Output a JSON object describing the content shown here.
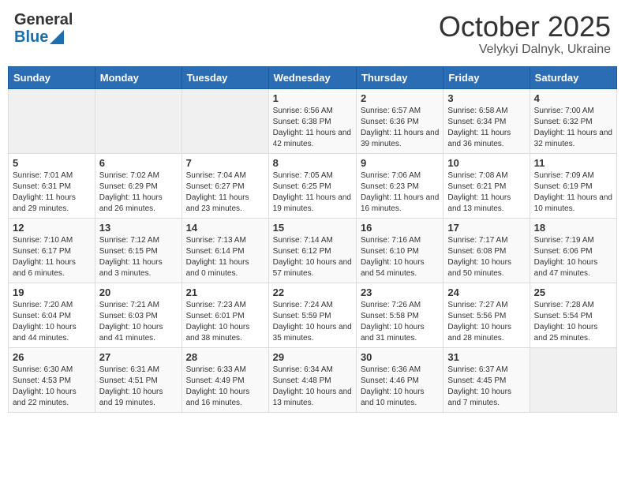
{
  "header": {
    "logo_general": "General",
    "logo_blue": "Blue",
    "month": "October 2025",
    "location": "Velykyi Dalnyk, Ukraine"
  },
  "weekdays": [
    "Sunday",
    "Monday",
    "Tuesday",
    "Wednesday",
    "Thursday",
    "Friday",
    "Saturday"
  ],
  "weeks": [
    [
      {
        "day": "",
        "info": ""
      },
      {
        "day": "",
        "info": ""
      },
      {
        "day": "",
        "info": ""
      },
      {
        "day": "1",
        "info": "Sunrise: 6:56 AM\nSunset: 6:38 PM\nDaylight: 11 hours and 42 minutes."
      },
      {
        "day": "2",
        "info": "Sunrise: 6:57 AM\nSunset: 6:36 PM\nDaylight: 11 hours and 39 minutes."
      },
      {
        "day": "3",
        "info": "Sunrise: 6:58 AM\nSunset: 6:34 PM\nDaylight: 11 hours and 36 minutes."
      },
      {
        "day": "4",
        "info": "Sunrise: 7:00 AM\nSunset: 6:32 PM\nDaylight: 11 hours and 32 minutes."
      }
    ],
    [
      {
        "day": "5",
        "info": "Sunrise: 7:01 AM\nSunset: 6:31 PM\nDaylight: 11 hours and 29 minutes."
      },
      {
        "day": "6",
        "info": "Sunrise: 7:02 AM\nSunset: 6:29 PM\nDaylight: 11 hours and 26 minutes."
      },
      {
        "day": "7",
        "info": "Sunrise: 7:04 AM\nSunset: 6:27 PM\nDaylight: 11 hours and 23 minutes."
      },
      {
        "day": "8",
        "info": "Sunrise: 7:05 AM\nSunset: 6:25 PM\nDaylight: 11 hours and 19 minutes."
      },
      {
        "day": "9",
        "info": "Sunrise: 7:06 AM\nSunset: 6:23 PM\nDaylight: 11 hours and 16 minutes."
      },
      {
        "day": "10",
        "info": "Sunrise: 7:08 AM\nSunset: 6:21 PM\nDaylight: 11 hours and 13 minutes."
      },
      {
        "day": "11",
        "info": "Sunrise: 7:09 AM\nSunset: 6:19 PM\nDaylight: 11 hours and 10 minutes."
      }
    ],
    [
      {
        "day": "12",
        "info": "Sunrise: 7:10 AM\nSunset: 6:17 PM\nDaylight: 11 hours and 6 minutes."
      },
      {
        "day": "13",
        "info": "Sunrise: 7:12 AM\nSunset: 6:15 PM\nDaylight: 11 hours and 3 minutes."
      },
      {
        "day": "14",
        "info": "Sunrise: 7:13 AM\nSunset: 6:14 PM\nDaylight: 11 hours and 0 minutes."
      },
      {
        "day": "15",
        "info": "Sunrise: 7:14 AM\nSunset: 6:12 PM\nDaylight: 10 hours and 57 minutes."
      },
      {
        "day": "16",
        "info": "Sunrise: 7:16 AM\nSunset: 6:10 PM\nDaylight: 10 hours and 54 minutes."
      },
      {
        "day": "17",
        "info": "Sunrise: 7:17 AM\nSunset: 6:08 PM\nDaylight: 10 hours and 50 minutes."
      },
      {
        "day": "18",
        "info": "Sunrise: 7:19 AM\nSunset: 6:06 PM\nDaylight: 10 hours and 47 minutes."
      }
    ],
    [
      {
        "day": "19",
        "info": "Sunrise: 7:20 AM\nSunset: 6:04 PM\nDaylight: 10 hours and 44 minutes."
      },
      {
        "day": "20",
        "info": "Sunrise: 7:21 AM\nSunset: 6:03 PM\nDaylight: 10 hours and 41 minutes."
      },
      {
        "day": "21",
        "info": "Sunrise: 7:23 AM\nSunset: 6:01 PM\nDaylight: 10 hours and 38 minutes."
      },
      {
        "day": "22",
        "info": "Sunrise: 7:24 AM\nSunset: 5:59 PM\nDaylight: 10 hours and 35 minutes."
      },
      {
        "day": "23",
        "info": "Sunrise: 7:26 AM\nSunset: 5:58 PM\nDaylight: 10 hours and 31 minutes."
      },
      {
        "day": "24",
        "info": "Sunrise: 7:27 AM\nSunset: 5:56 PM\nDaylight: 10 hours and 28 minutes."
      },
      {
        "day": "25",
        "info": "Sunrise: 7:28 AM\nSunset: 5:54 PM\nDaylight: 10 hours and 25 minutes."
      }
    ],
    [
      {
        "day": "26",
        "info": "Sunrise: 6:30 AM\nSunset: 4:53 PM\nDaylight: 10 hours and 22 minutes."
      },
      {
        "day": "27",
        "info": "Sunrise: 6:31 AM\nSunset: 4:51 PM\nDaylight: 10 hours and 19 minutes."
      },
      {
        "day": "28",
        "info": "Sunrise: 6:33 AM\nSunset: 4:49 PM\nDaylight: 10 hours and 16 minutes."
      },
      {
        "day": "29",
        "info": "Sunrise: 6:34 AM\nSunset: 4:48 PM\nDaylight: 10 hours and 13 minutes."
      },
      {
        "day": "30",
        "info": "Sunrise: 6:36 AM\nSunset: 4:46 PM\nDaylight: 10 hours and 10 minutes."
      },
      {
        "day": "31",
        "info": "Sunrise: 6:37 AM\nSunset: 4:45 PM\nDaylight: 10 hours and 7 minutes."
      },
      {
        "day": "",
        "info": ""
      }
    ]
  ]
}
